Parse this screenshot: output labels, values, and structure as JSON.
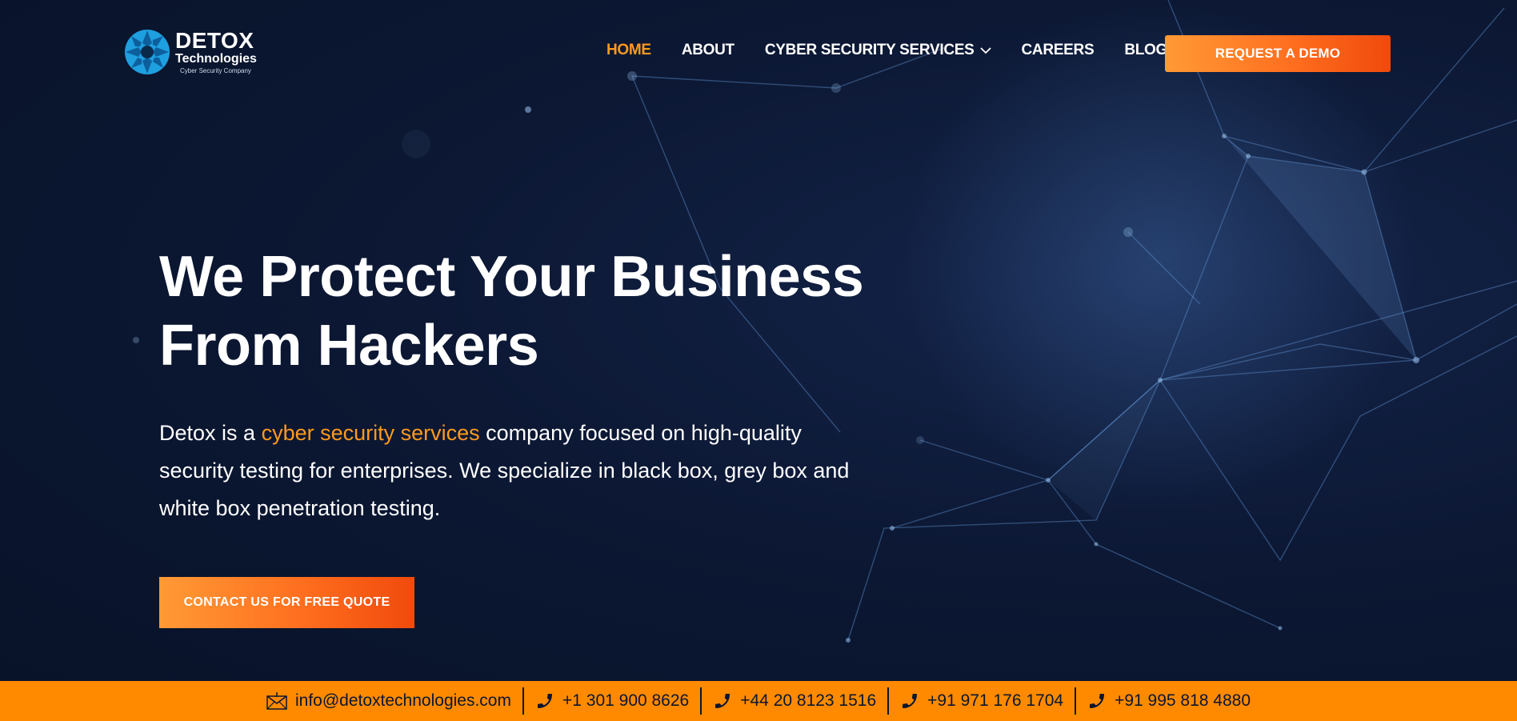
{
  "brand": {
    "title": "DETOX",
    "subtitle": "Technologies",
    "tagline": "Cyber Security Company",
    "colors": {
      "accent": "#ff9a1f",
      "cta_start": "#ff9a35",
      "cta_end": "#f04a0c",
      "bar": "#ff8a00",
      "bg": "#0c1834"
    }
  },
  "nav": {
    "items": [
      {
        "label": "HOME",
        "active": true
      },
      {
        "label": "ABOUT"
      },
      {
        "label": "CYBER SECURITY SERVICES",
        "has_dropdown": true
      },
      {
        "label": "CAREERS"
      },
      {
        "label": "BLOG"
      }
    ],
    "demo_button": "REQUEST A DEMO"
  },
  "hero": {
    "title_line1": "We Protect Your Business",
    "title_line2": "From Hackers",
    "desc_before": "Detox is a ",
    "desc_highlight": "cyber security services",
    "desc_after": " company focused on high-quality security testing for enterprises. We specialize in black box, grey box and white box penetration testing.",
    "cta_label": "CONTACT US FOR FREE QUOTE"
  },
  "contact": {
    "email": "info@detoxtechnologies.com",
    "phones": [
      "+1 301 900 8626",
      "+44 20 8123 1516",
      "+91 971 176 1704",
      "+91 995 818 4880"
    ]
  }
}
